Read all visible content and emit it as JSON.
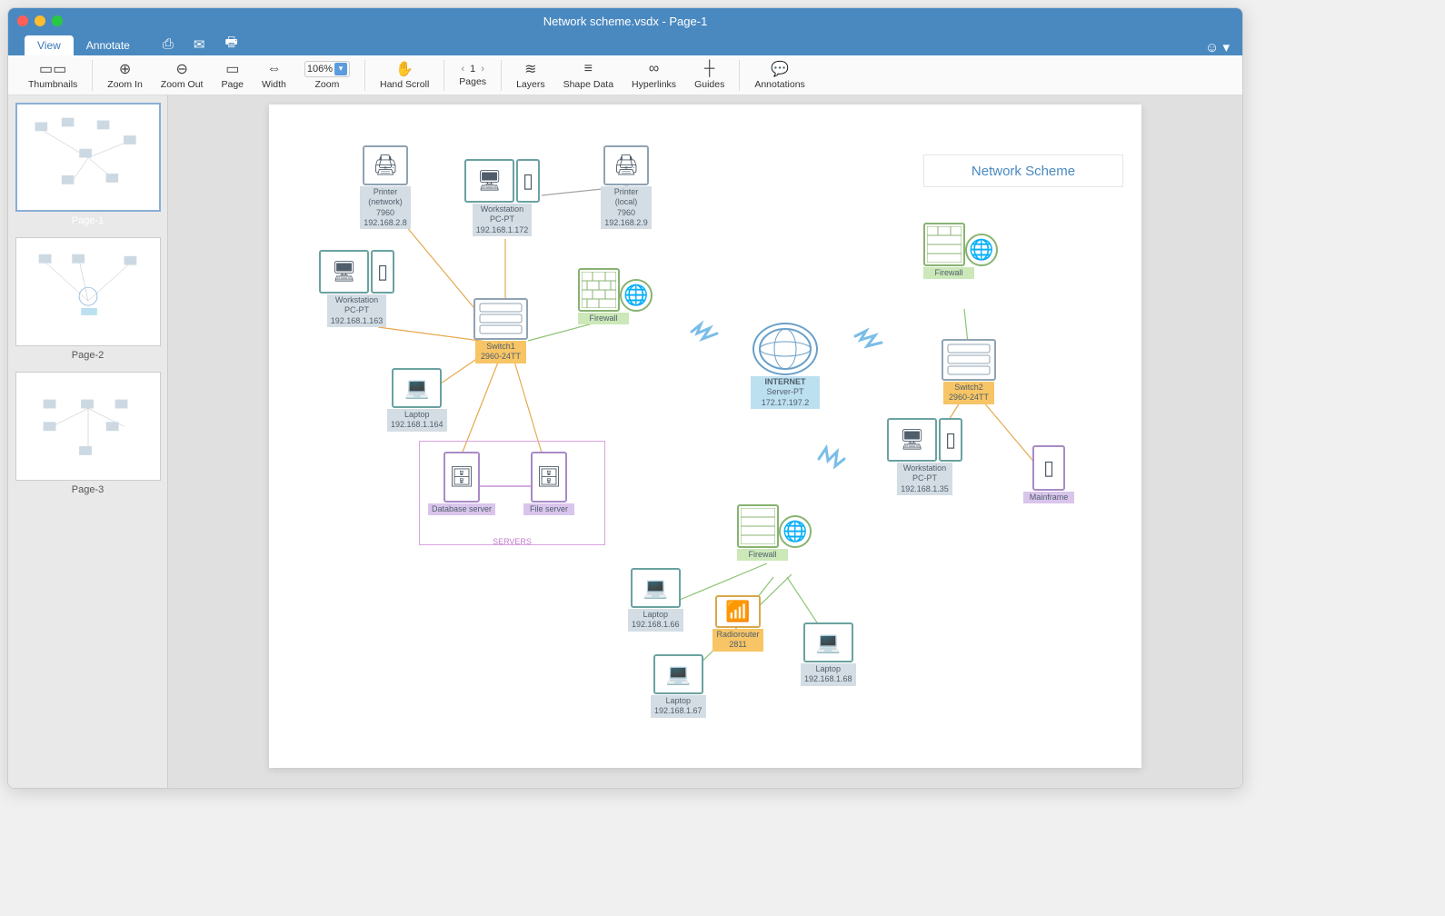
{
  "window": {
    "title": "Network scheme.vsdx - Page-1"
  },
  "tabs": {
    "view": "View",
    "annotate": "Annotate"
  },
  "toolbar": {
    "thumbnails": "Thumbnails",
    "zoom_in": "Zoom In",
    "zoom_out": "Zoom Out",
    "page": "Page",
    "width": "Width",
    "zoom_value": "106%",
    "zoom": "Zoom",
    "hand_scroll": "Hand Scroll",
    "pages_current": "1",
    "pages": "Pages",
    "layers": "Layers",
    "shape_data": "Shape Data",
    "hyperlinks": "Hyperlinks",
    "guides": "Guides",
    "annotations": "Annotations"
  },
  "thumbnails": [
    {
      "label": "Page-1"
    },
    {
      "label": "Page-2"
    },
    {
      "label": "Page-3"
    }
  ],
  "diagram": {
    "title": "Network Scheme",
    "servers_group": "SERVERS",
    "nodes": {
      "printer_net": {
        "name": "Printer",
        "sub": "(network)",
        "id": "7960",
        "ip": "192.168.2.8"
      },
      "workstation1": {
        "name": "Workstation",
        "sub": "PC-PT",
        "ip": "192.168.1.172"
      },
      "printer_local": {
        "name": "Printer",
        "sub": "(local)",
        "id": "7960",
        "ip": "192.168.2.9"
      },
      "workstation2": {
        "name": "Workstation",
        "sub": "PC-PT",
        "ip": "192.168.1.163"
      },
      "switch1": {
        "name": "Switch1",
        "sub": "2960-24TT"
      },
      "firewall1": {
        "name": "Firewall"
      },
      "laptop1": {
        "name": "Laptop",
        "ip": "192.168.1.164"
      },
      "db_server": {
        "name": "Database server"
      },
      "file_server": {
        "name": "File server"
      },
      "internet": {
        "name": "INTERNET",
        "sub": "Server-PT",
        "ip": "172.17.197.2"
      },
      "firewall_top": {
        "name": "Firewall"
      },
      "switch2": {
        "name": "Switch2",
        "sub": "2960-24TT"
      },
      "workstation3": {
        "name": "Workstation",
        "sub": "PC-PT",
        "ip": "192.168.1.35"
      },
      "mainframe": {
        "name": "Mainframe"
      },
      "firewall_bot": {
        "name": "Firewall"
      },
      "radiorouter": {
        "name": "Radiorouter",
        "sub": "2811"
      },
      "laptop_a": {
        "name": "Laptop",
        "ip": "192.168.1.66"
      },
      "laptop_b": {
        "name": "Laptop",
        "ip": "192.168.1.67"
      },
      "laptop_c": {
        "name": "Laptop",
        "ip": "192.168.1.68"
      }
    }
  }
}
